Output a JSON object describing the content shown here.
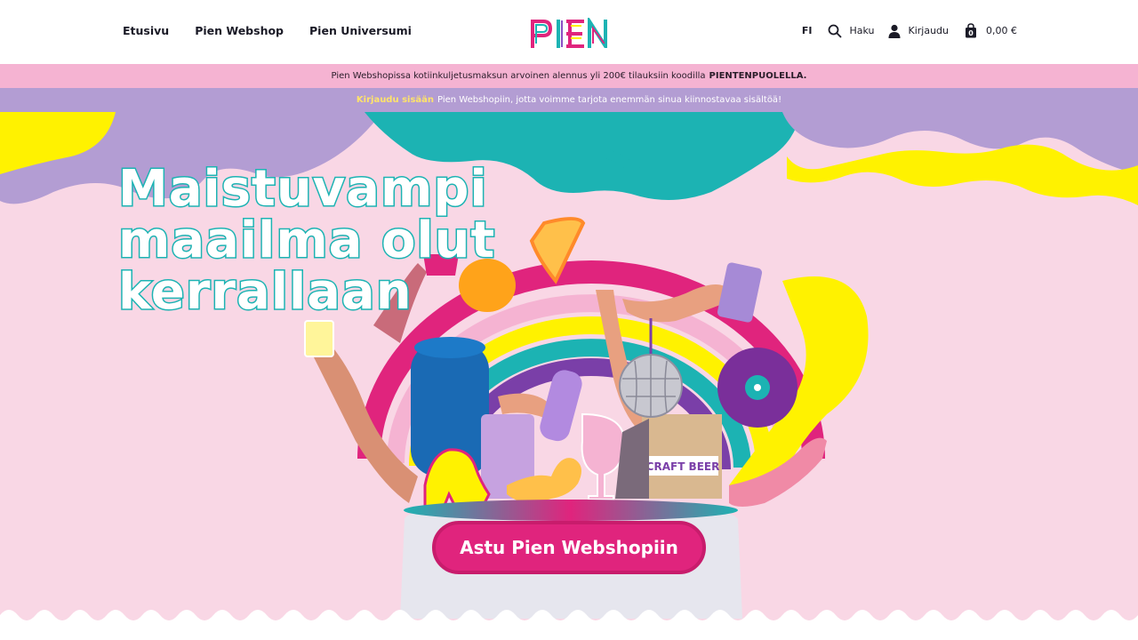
{
  "nav": {
    "items": [
      {
        "label": "Etusivu"
      },
      {
        "label": "Pien Webshop"
      },
      {
        "label": "Pien Universumi"
      }
    ],
    "logo_text": "PIEN",
    "lang": "FI",
    "search_label": "Haku",
    "login_label": "Kirjaudu",
    "cart_count": "0",
    "cart_total": "0,00 €"
  },
  "banner1": {
    "text": "Pien Webshopissa kotiinkuljetusmaksun arvoinen alennus yli 200€ tilauksiin koodilla",
    "code": "PIENTENPUOLELLA."
  },
  "banner2": {
    "link": "Kirjaudu sisään",
    "text": "Pien Webshopiin, jotta voimme tarjota enemmän sinua kiinnostavaa sisältöä!"
  },
  "hero": {
    "headline": [
      "Maistuvampi",
      "maailma olut",
      "kerrallaan"
    ],
    "cta_label": "Astu Pien Webshopiin",
    "sign_text": "CRAFT BEER"
  },
  "colors": {
    "accent_pink": "#e0247d",
    "teal": "#1cb3b3",
    "purple": "#b39dd3",
    "yellow": "#fff200",
    "banner_pink": "#f5b3d2",
    "hero_bg": "#f9d7e5"
  }
}
